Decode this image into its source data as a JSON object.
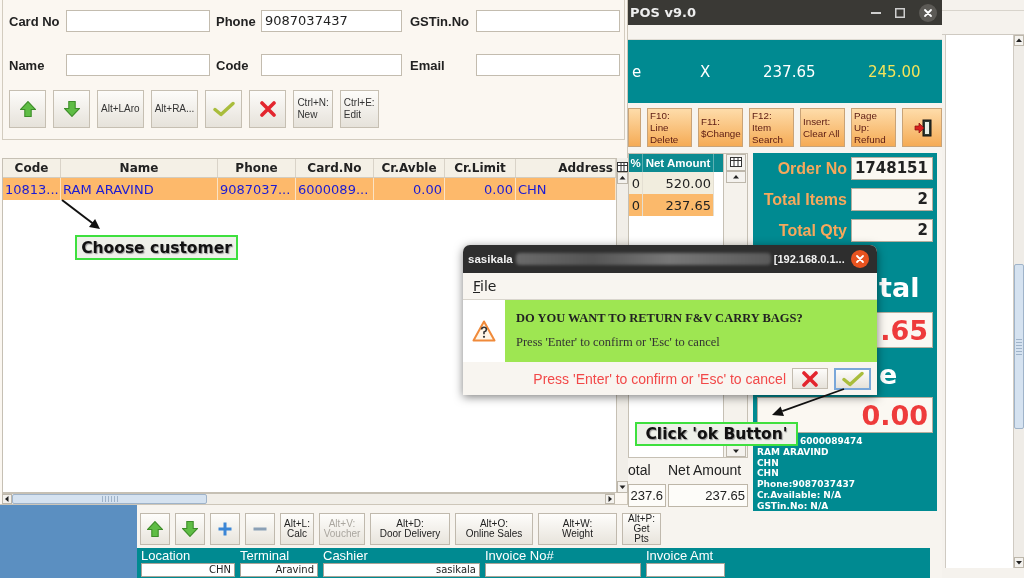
{
  "customer_search": {
    "fields": [
      {
        "label": "Card No"
      },
      {
        "label": "Phone",
        "value": "9087037437"
      },
      {
        "label": "GSTin.No"
      },
      {
        "label": "Name"
      },
      {
        "label": "Code"
      },
      {
        "label": "Email"
      }
    ],
    "toolbar": [
      {
        "kind": "up"
      },
      {
        "kind": "down"
      },
      {
        "kind": "text",
        "label": "Alt+LAro"
      },
      {
        "kind": "text",
        "label": "Alt+RA..."
      },
      {
        "kind": "tick"
      },
      {
        "kind": "cross"
      },
      {
        "kind": "text",
        "label": "Ctrl+N:\nNew"
      },
      {
        "kind": "text",
        "label": "Ctrl+E:\nEdit"
      }
    ],
    "table": {
      "columns": [
        "Code",
        "Name",
        "Phone",
        "Card.No",
        "Cr.Avble",
        "Cr.Limit",
        "Address"
      ],
      "rows": [
        {
          "selected": true,
          "cells": [
            "10813...",
            "RAM ARAVIND",
            "9087037...",
            "6000089...",
            "0.00",
            "0.00",
            "CHN"
          ]
        }
      ]
    },
    "annotation": "Choose customer"
  },
  "pos": {
    "title": "POS v9.0",
    "header": [
      {
        "text": "e",
        "highlight": false
      },
      {
        "text": "X",
        "highlight": false
      },
      {
        "text": "237.65",
        "highlight": false
      },
      {
        "text": "245.00",
        "highlight": true
      }
    ],
    "function_keys": [
      {
        "kind": "partial"
      },
      {
        "kind": "text",
        "label": "F10:\nLine\nDelete"
      },
      {
        "kind": "text",
        "label": "F11:\n$Change"
      },
      {
        "kind": "text",
        "label": "F12:\nItem\nSearch"
      },
      {
        "kind": "text",
        "label": "Insert:\nClear All"
      },
      {
        "kind": "text",
        "label": "Page\nUp:\nRefund"
      },
      {
        "kind": "exit"
      }
    ],
    "items": {
      "columns": [
        "%",
        "Net Amount"
      ],
      "rows": [
        {
          "selected": false,
          "cells": [
            "0",
            "520.00"
          ]
        },
        {
          "selected": true,
          "cells": [
            "0",
            "237.65"
          ]
        }
      ]
    },
    "totals": [
      {
        "label": "otal",
        "value": "237.6"
      },
      {
        "label": "Net Amount",
        "value": "237.65"
      }
    ],
    "summary": [
      {
        "label": "Order No",
        "value": "1748151"
      },
      {
        "label": "Total Items",
        "value": "2"
      },
      {
        "label": "Total Qty",
        "value": "2"
      }
    ],
    "net_total": {
      "label": "tal",
      "value": ".65"
    },
    "change": {
      "label": "e",
      "value": "0.00"
    },
    "customer_info": [
      "6000089474",
      "RAM ARAVIND",
      "CHN",
      "CHN",
      "Phone:9087037437",
      "Cr.Available: N/A",
      "GSTin.No: N/A"
    ],
    "actions": [
      {
        "kind": "up"
      },
      {
        "kind": "down"
      },
      {
        "kind": "plus"
      },
      {
        "kind": "minus"
      },
      {
        "kind": "text",
        "label": "Alt+L:\nCalc",
        "disabled": false
      },
      {
        "kind": "text",
        "label": "Alt+V:\nVoucher",
        "disabled": true
      },
      {
        "kind": "text",
        "label": "Alt+D:\nDoor Delivery",
        "disabled": false
      },
      {
        "kind": "text",
        "label": "Alt+O:\nOnline Sales",
        "disabled": false
      },
      {
        "kind": "text",
        "label": "Alt+W:\nWeight",
        "disabled": false
      },
      {
        "kind": "text",
        "label": "Alt+P:\nGet\nPts",
        "disabled": false
      }
    ],
    "status": [
      {
        "label": "Location",
        "value": "CHN"
      },
      {
        "label": "Terminal",
        "value": "Aravind"
      },
      {
        "label": "Cashier",
        "value": "sasikala"
      },
      {
        "label": "Invoice No#"
      },
      {
        "label": "Invoice Amt"
      }
    ]
  },
  "dialog": {
    "title": "sasikala",
    "title_blurred": true,
    "host": "[192.168.0.1...",
    "menu": [
      "File"
    ],
    "question": "DO YOU WANT TO RETURN F&V CARRY BAGS?",
    "hint": "Press 'Enter' to confirm or 'Esc' to cancel",
    "footer": "Press 'Enter' to confirm or 'Esc' to cancel",
    "buttons": [
      {
        "kind": "cross",
        "focused": false
      },
      {
        "kind": "tick",
        "focused": true
      }
    ],
    "annotation": "Click 'ok Button'"
  }
}
